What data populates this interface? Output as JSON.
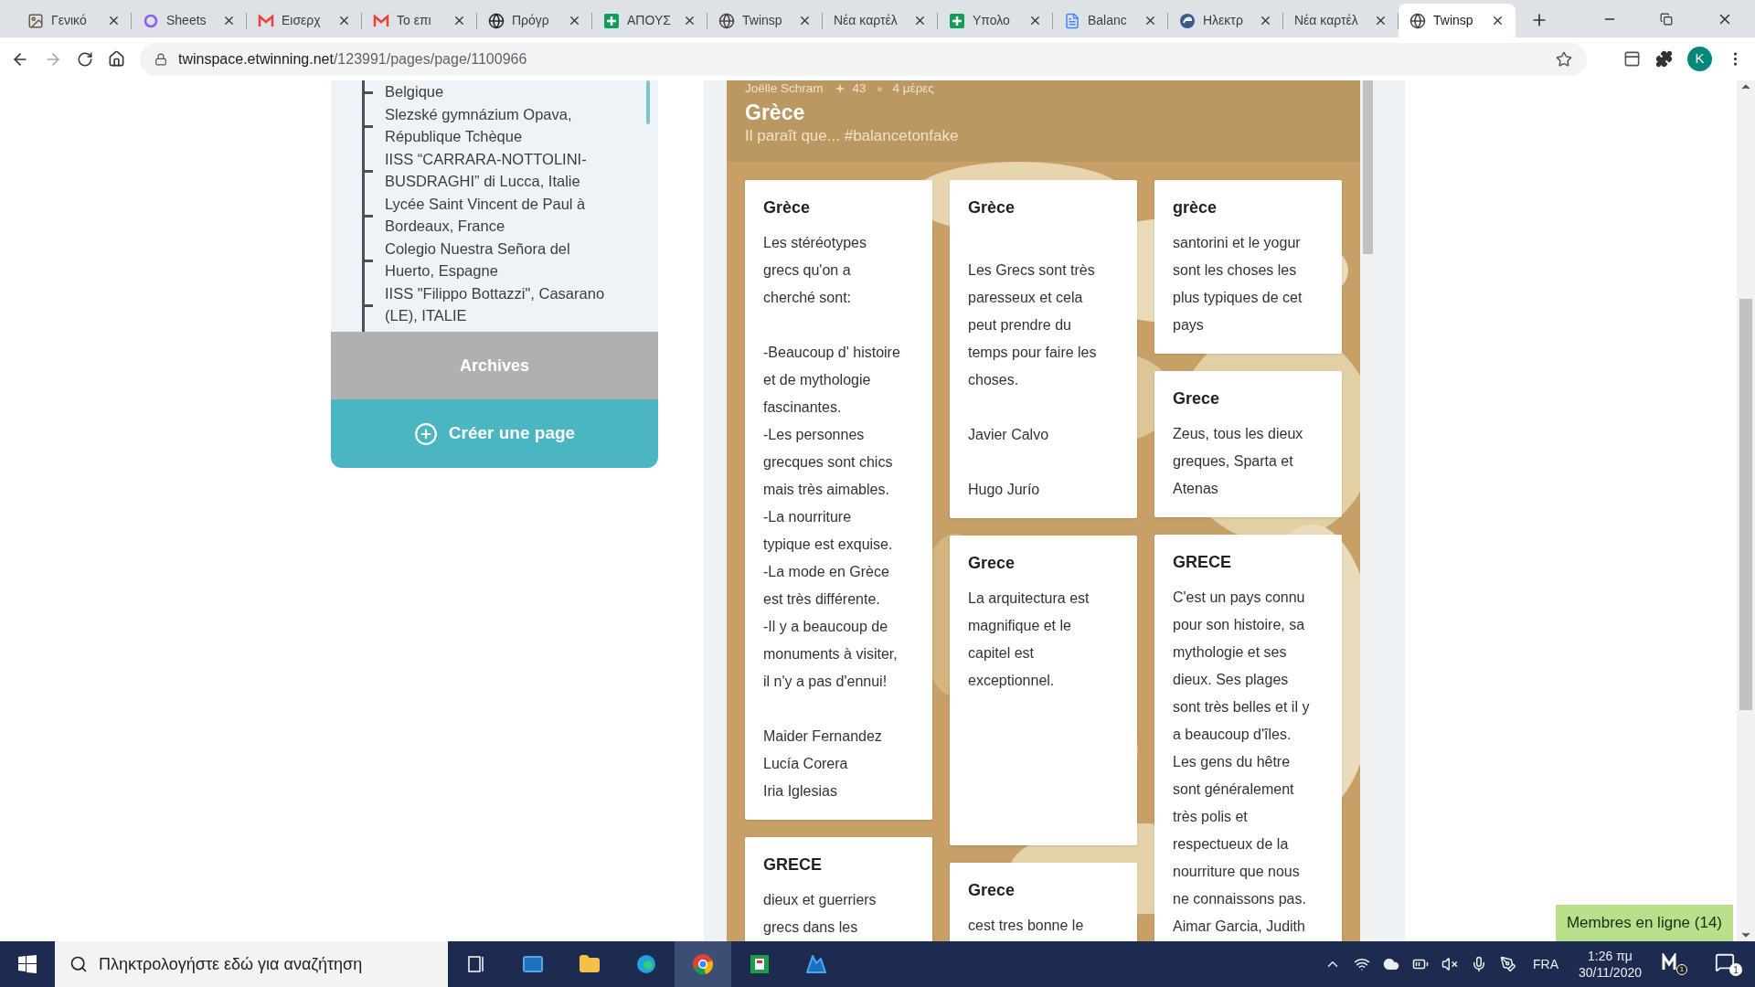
{
  "browser": {
    "tabs": [
      {
        "title": "Γενικό",
        "selected": false
      },
      {
        "title": "Sheets",
        "selected": false
      },
      {
        "title": "Εισερχ",
        "selected": false
      },
      {
        "title": "Το επι",
        "selected": false
      },
      {
        "title": "Πρόγρ",
        "selected": false
      },
      {
        "title": "ΑΠΟΥΣ",
        "selected": false
      },
      {
        "title": "Twinsp",
        "selected": false
      },
      {
        "title": "Νέα καρτέλ",
        "selected": false
      },
      {
        "title": "Υπολο",
        "selected": false
      },
      {
        "title": "Balanc",
        "selected": false
      },
      {
        "title": "Ηλεκτρ",
        "selected": false
      },
      {
        "title": "Νέα καρτέλ",
        "selected": false
      },
      {
        "title": "Twinsp",
        "selected": true
      }
    ],
    "address": {
      "host": "twinspace.etwinning.net",
      "path": "/123991/pages/page/1100966"
    },
    "profile_initial": "K"
  },
  "sidebar": {
    "items": [
      "Belgique",
      "Slezské gymnázium Opava,\nRépublique Tchèque",
      "IISS “CARRARA-NOTTOLINI-\nBUSDRAGHI” di Lucca, Italie",
      "Lycée Saint Vincent de Paul à\nBordeaux, France",
      "Colegio Nuestra Señora del\nHuerto, Espagne",
      "IISS \"Filippo Bottazzi\", Casarano\n(LE), ITALIE"
    ],
    "archives": "Archives",
    "create_page": "Créer une page"
  },
  "padlet": {
    "author": "Joëlle Schram",
    "likes": "43",
    "age": "4 μέρες",
    "title": "Grèce",
    "subtitle": "Il paraît que... #balancetonfake",
    "columns": [
      [
        {
          "title": "Grèce",
          "body": "Les stéréotypes\ngrecs qu'on a\ncherché sont:\n\n-Beaucoup d' histoire\net de mythologie\nfascinantes.\n-Les personnes\ngrecques sont chics\nmais très aimables.\n-La nourriture\ntypique est exquise.\n-La mode en Grèce\nest très différente.\n-Il y a beaucoup de\nmonuments à visiter,\nil n'y a pas d'ennui!\n\nMaider Fernandez\nLucía Corera\nIria Iglesias"
        },
        {
          "title": "GRECE",
          "body": "dieux et guerriers\ngrecs dans les"
        }
      ],
      [
        {
          "title": "Grèce",
          "body": "\nLes Grecs sont très\nparesseux et cela\npeut prendre du\ntemps pour faire les\nchoses.\n\nJavier Calvo\n\nHugo Jurío"
        },
        {
          "title": "Grece",
          "body": "La arquitectura est\nmagnifique et le\ncapitel est\nexceptionnel."
        },
        {
          "title": "Grece",
          "body": "cest tres bonne le"
        }
      ],
      [
        {
          "title": "grèce",
          "body": "santorini et le yogur\nsont les choses les\nplus typiques de cet\npays"
        },
        {
          "title": "Grece",
          "body": "Zeus, tous les dieux\ngreques, Sparta et\nAtenas"
        },
        {
          "title": "GRECE",
          "body": "C'est un pays connu\npour son histoire, sa\nmythologie et ses\ndieux. Ses plages\nsont très belles et il y\na beaucoup d'îles.\nLes gens du hêtre\nsont généralement\ntrès polis et\nrespectueux de la\nnourriture que nous\nne connaissons pas.\nAimar Garcia, Judith"
        }
      ]
    ]
  },
  "online_members": "Membres en ligne (14)",
  "taskbar": {
    "search_placeholder": "Πληκτρολογήστε εδώ για αναζήτηση",
    "language": "FRA",
    "time": "1:26 πμ",
    "date": "30/11/2020",
    "mail_badge": "1",
    "notification_count": "1"
  }
}
